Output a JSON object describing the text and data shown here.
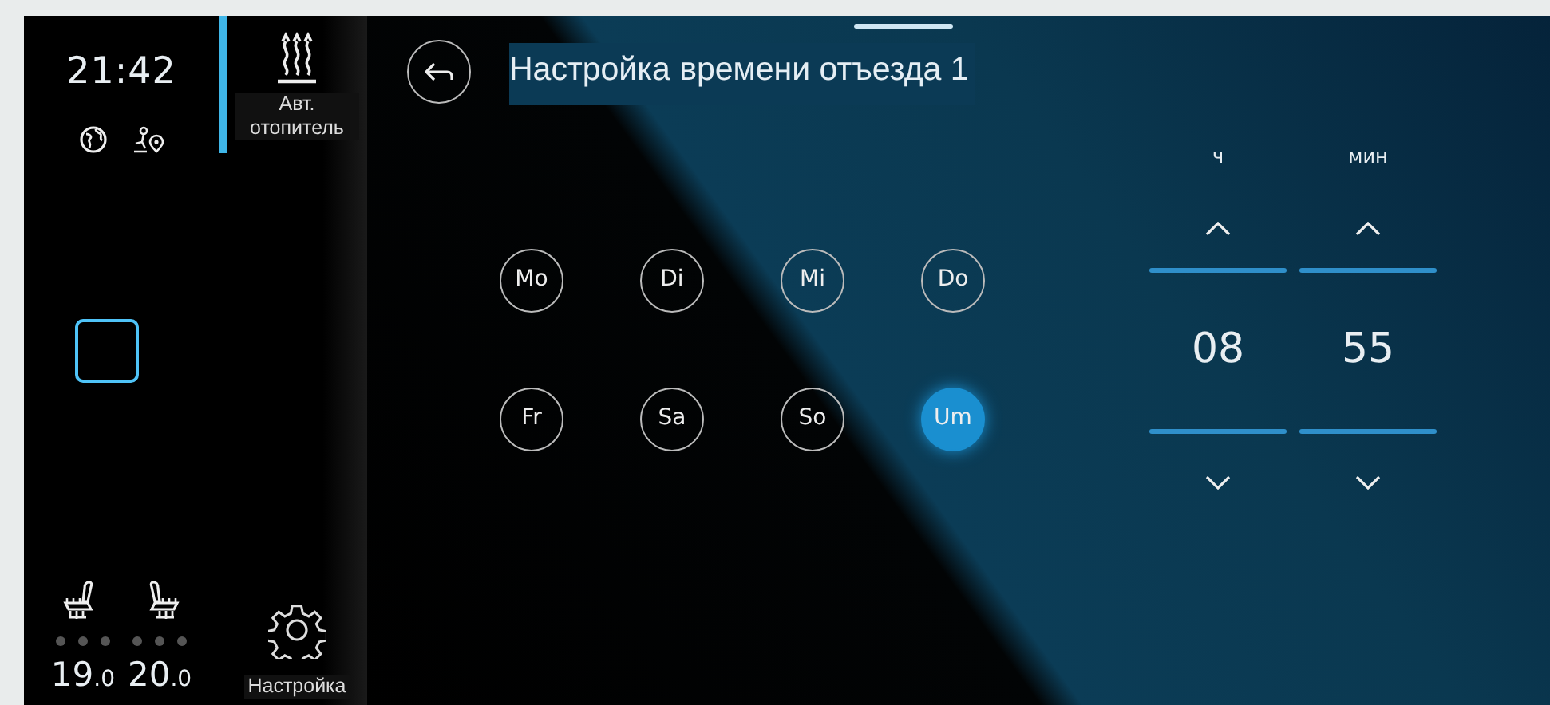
{
  "status": {
    "time": "21:42"
  },
  "sidebar": {
    "items": [
      {
        "label": "Авт. отопитель",
        "kind": "heater",
        "selected": true
      },
      {
        "label": "Настройка",
        "kind": "settings",
        "selected": false
      }
    ]
  },
  "seats": [
    {
      "kind": "driver",
      "stars": 0,
      "temperature": "19.0"
    },
    {
      "kind": "passenger",
      "stars": 0,
      "temperature": "20.0"
    }
  ],
  "header": {
    "title": "Настройка времени отъезда 1"
  },
  "days": [
    {
      "label": "Mo",
      "selected": false
    },
    {
      "label": "Di",
      "selected": false
    },
    {
      "label": "Mi",
      "selected": false
    },
    {
      "label": "Do",
      "selected": false
    },
    {
      "label": "Fr",
      "selected": false
    },
    {
      "label": "Sa",
      "selected": false
    },
    {
      "label": "So",
      "selected": false
    },
    {
      "label": "Um",
      "selected": true
    }
  ],
  "time_picker": [
    {
      "unit": "ч",
      "value": "08"
    },
    {
      "unit": "мин",
      "value": "55"
    }
  ]
}
